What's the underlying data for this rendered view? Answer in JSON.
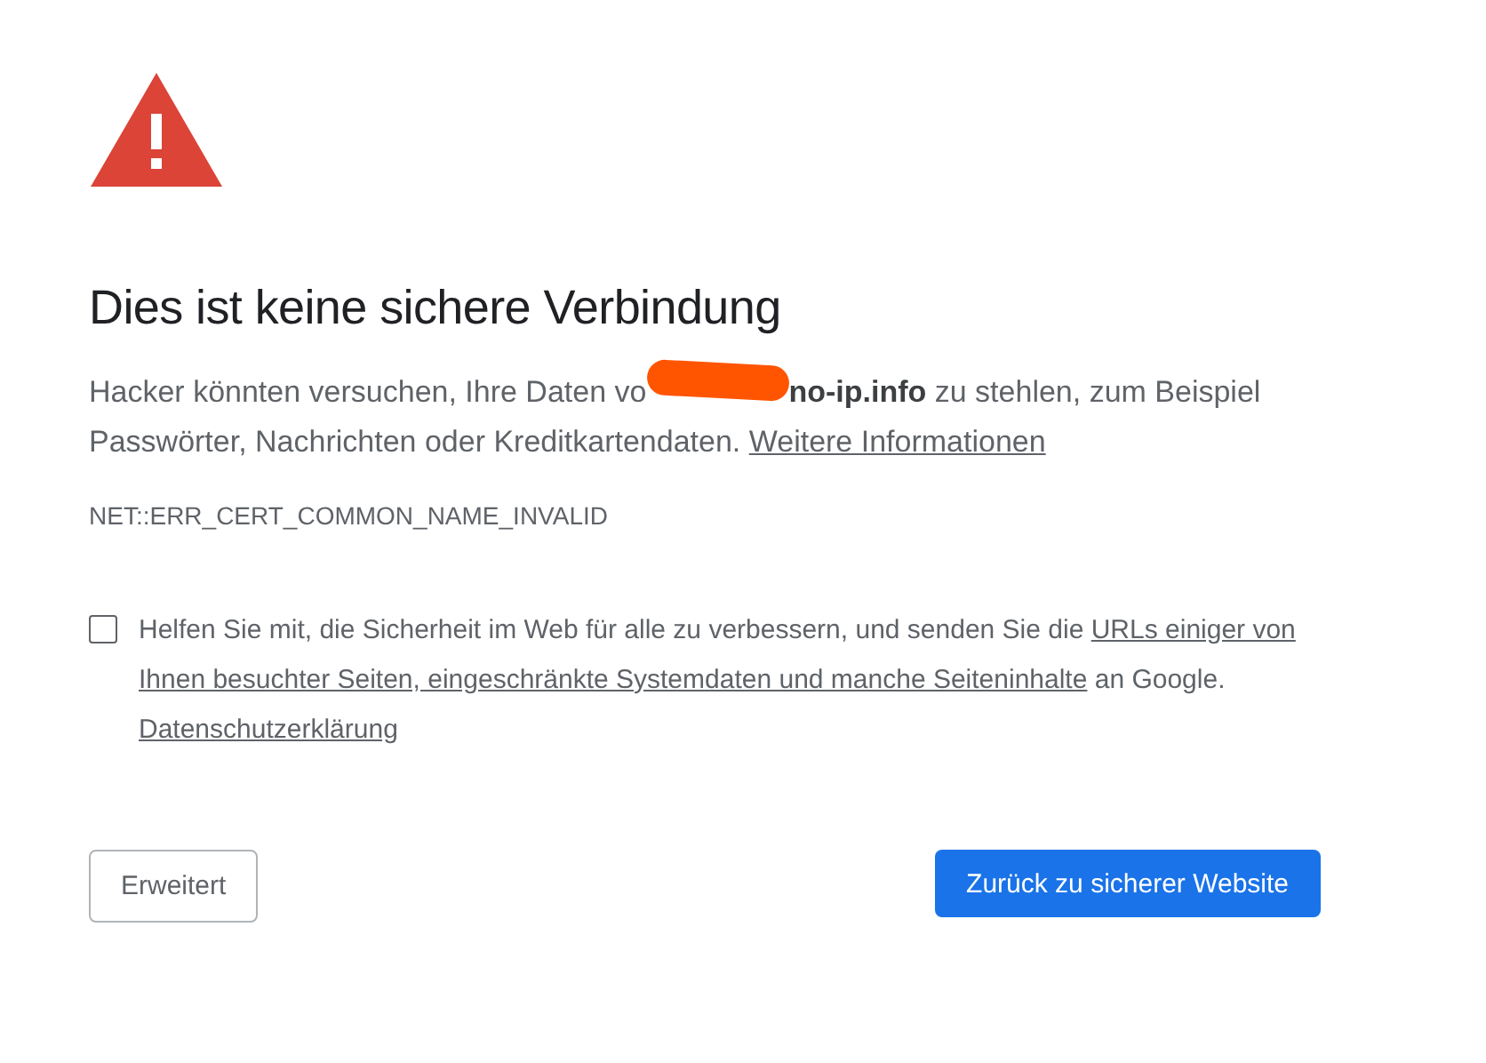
{
  "heading": "Dies ist keine sichere Verbindung",
  "intro": {
    "before": "Hacker könnten versuchen, Ihre Daten vo",
    "domain": "no-ip.info",
    "after": " zu stehlen, zum Beispiel Passwörter, Nachrichten oder Kreditkartendaten. ",
    "link": "Weitere Informationen"
  },
  "error_code": "NET::ERR_CERT_COMMON_NAME_INVALID",
  "optin": {
    "checked": false,
    "before": "Helfen Sie mit, die Sicherheit im Web für alle zu verbessern, und senden Sie die ",
    "link": [
      "URLs einiger von",
      "Ihnen besuchter Seiten, eingeschränkte Systemdaten und manche Seiteninhalte"
    ],
    "after": " an Google. ",
    "privacy_link": "Datenschutzerklärung"
  },
  "buttons": {
    "secondary": "Erweitert",
    "primary": "Zurück zu sicherer Website"
  }
}
